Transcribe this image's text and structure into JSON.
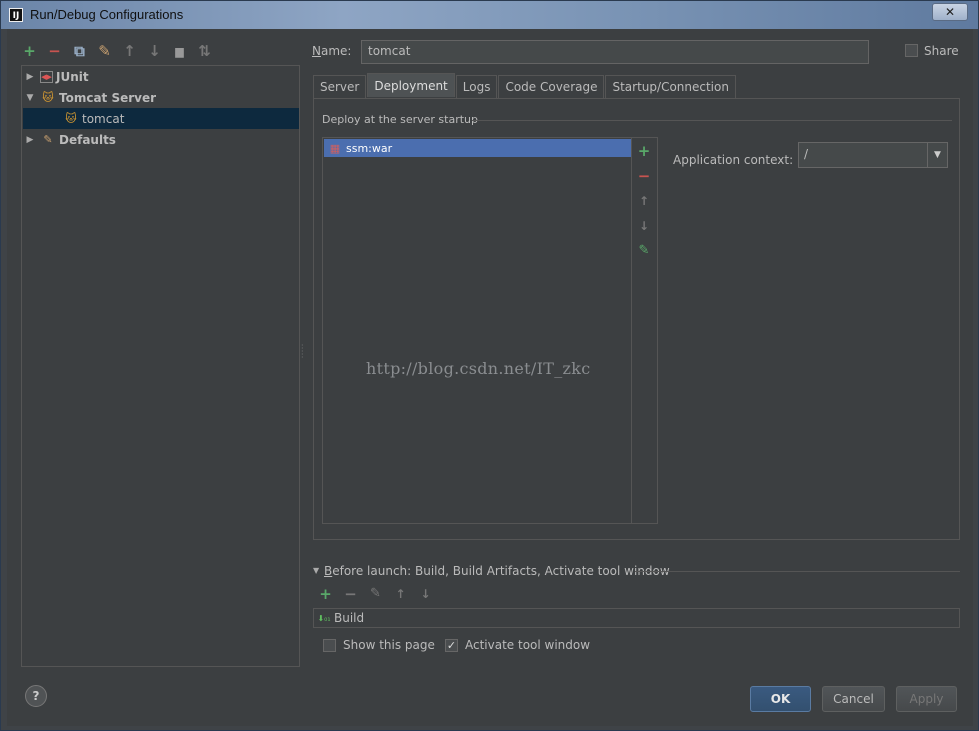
{
  "window": {
    "title": "Run/Debug Configurations",
    "app_icon": "IJ",
    "close_glyph": "✕"
  },
  "toolbar": {
    "icons": [
      {
        "name": "add-icon",
        "glyph": "+",
        "color": "#59a869"
      },
      {
        "name": "remove-icon",
        "glyph": "−",
        "color": "#c75450"
      },
      {
        "name": "copy-icon",
        "glyph": "⧉",
        "color": "#9ab0c8"
      },
      {
        "name": "wrench-icon",
        "glyph": "✎",
        "color": "#c8a070"
      },
      {
        "name": "move-up-icon",
        "glyph": "↑",
        "color": "#777777"
      },
      {
        "name": "move-down-icon",
        "glyph": "↓",
        "color": "#777777"
      },
      {
        "name": "folder-icon",
        "glyph": "▆",
        "color": "#a0a0a0"
      },
      {
        "name": "sort-icon",
        "glyph": "⇅",
        "color": "#777777"
      }
    ]
  },
  "tree": {
    "items": [
      {
        "label": "JUnit",
        "expanded": false,
        "icon": "junit-icon"
      },
      {
        "label": "Tomcat Server",
        "expanded": true,
        "icon": "tomcat-icon"
      },
      {
        "label": "tomcat",
        "selected": true,
        "icon": "tomcat-icon"
      },
      {
        "label": "Defaults",
        "expanded": false,
        "icon": "wrench-icon"
      }
    ]
  },
  "name": {
    "label_prefix": "N",
    "label_rest": "ame:",
    "value": "tomcat"
  },
  "share": {
    "label": "Share",
    "checked": false
  },
  "tabs": [
    {
      "label": "Server",
      "active": false
    },
    {
      "label": "Deployment",
      "active": true
    },
    {
      "label": "Logs",
      "active": false
    },
    {
      "label": "Code Coverage",
      "active": false
    },
    {
      "label": "Startup/Connection",
      "active": false
    }
  ],
  "deployment": {
    "section_title": "Deploy at the server startup",
    "artifacts": [
      "ssm:war"
    ],
    "app_context_label": "Application context:",
    "app_context_value": "/"
  },
  "watermark": "http://blog.csdn.net/IT_zkc",
  "before_launch": {
    "label_prefix": "B",
    "label_rest": "efore launch: Build, Build Artifacts, Activate tool window",
    "tasks": [
      "Build"
    ]
  },
  "options": {
    "show_this_page": {
      "label": "Show this page",
      "checked": false
    },
    "activate_tool_window": {
      "label": "Activate tool window",
      "checked": true
    }
  },
  "buttons": {
    "ok": "OK",
    "cancel": "Cancel",
    "apply": "Apply",
    "help": "?"
  },
  "colors": {
    "selection": "#4b6eaf",
    "tree_selection": "#0d293e",
    "background": "#3c3f41"
  }
}
